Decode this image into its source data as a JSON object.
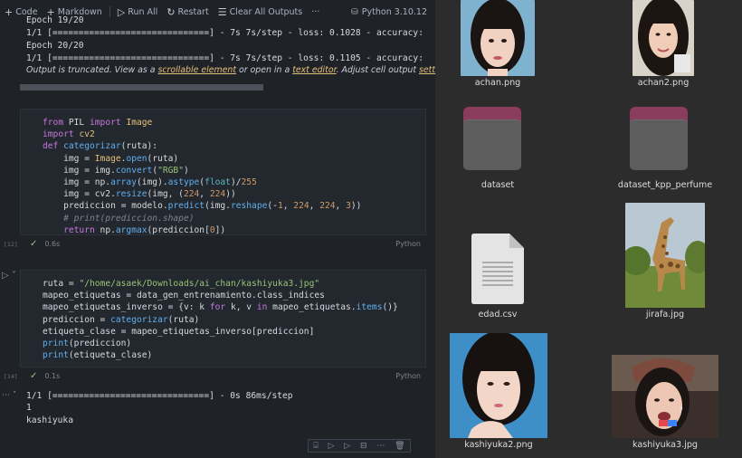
{
  "toolbar": {
    "code_label": "Code",
    "markdown_label": "Markdown",
    "run_all_label": "Run All",
    "restart_label": "Restart",
    "clear_outputs_label": "Clear All Outputs",
    "more_label": "···",
    "kernel_label": "Python 3.10.12"
  },
  "top_output": {
    "lines": [
      "Epoch 19/20",
      "1/1 [==============================] - 7s 7s/step - loss: 0.1028 - accuracy:",
      "Epoch 20/20",
      "1/1 [==============================] - 7s 7s/step - loss: 0.1105 - accuracy:"
    ],
    "truncated_prefix": "Output is truncated. View as a ",
    "scrollable_link": "scrollable element",
    "or_open": " or open in a ",
    "text_editor_link": "text editor",
    "adjust": ". Adjust cell output ",
    "settings_link": "settings",
    "ellipsis": "..."
  },
  "cell1": {
    "exec_count": "[12]",
    "time": "0.6s",
    "language": "Python"
  },
  "cell2": {
    "exec_count": "[14]",
    "time": "0.1s",
    "language": "Python"
  },
  "bottom_output": {
    "line1": "1/1 [==============================] - 0s 86ms/step",
    "line2": "1",
    "line3": "kashiyuka"
  },
  "files": {
    "achan": "achan.png",
    "achan2": "achan2.png",
    "dataset": "dataset",
    "dataset_kpp": "dataset_kpp_perfume",
    "edad": "edad.csv",
    "jirafa": "jirafa.jpg",
    "kashiyuka2": "kashiyuka2.png",
    "kashiyuka3": "kashiyuka3.jpg"
  },
  "colors": {
    "editor_bg": "#1f2227",
    "cell_bg": "#23272e",
    "files_bg": "#2c2c2c",
    "folder_tab": "#8a3d5c",
    "link": "#e5c07b"
  }
}
